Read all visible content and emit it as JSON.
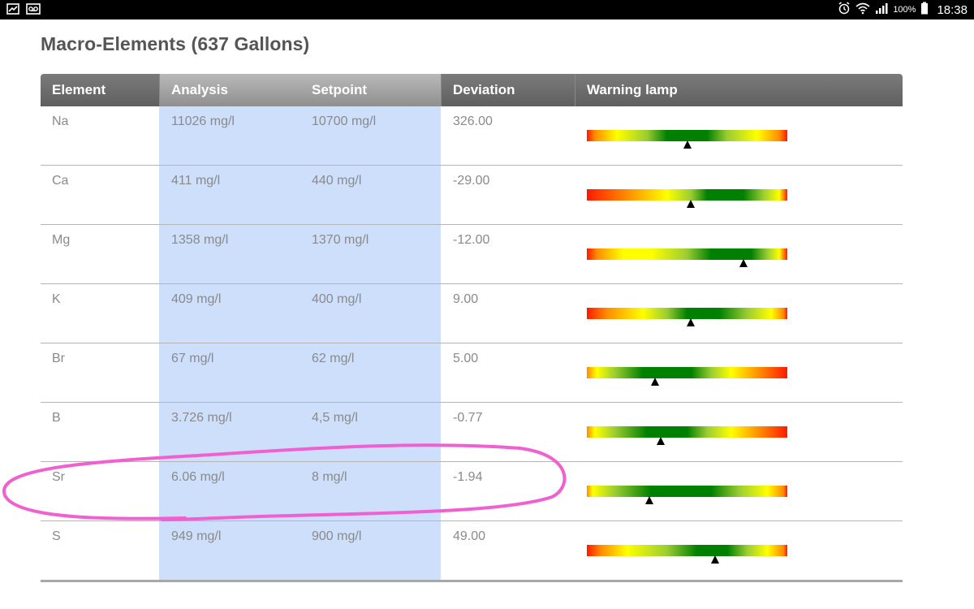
{
  "status_bar": {
    "left_icons": [
      "image-icon",
      "voicemail-icon"
    ],
    "right_icons": [
      "alarm-icon",
      "wifi-icon",
      "signal-icon",
      "battery-icon"
    ],
    "battery": "100%",
    "time": "18:38"
  },
  "title": "Macro-Elements (637 Gallons)",
  "table": {
    "headers": {
      "element": "Element",
      "analysis": "Analysis",
      "setpoint": "Setpoint",
      "deviation": "Deviation",
      "warning_lamp": "Warning lamp"
    },
    "rows": [
      {
        "element": "Na",
        "analysis": "11026 mg/l",
        "setpoint": "10700 mg/l",
        "deviation": "326.00",
        "lamp_level": 0.5,
        "lamp_gradient": "linear-gradient(to right,#ff1a00 0%,#ff8c00 4%,#ffff00 15%,#9acd32 30%,#008000 40%,#008000 60%,#9acd32 70%,#ffff00 85%,#ff8c00 96%,#ff1a00 100%)"
      },
      {
        "element": "Ca",
        "analysis": "411 mg/l",
        "setpoint": "440 mg/l",
        "deviation": "-29.00",
        "lamp_level": 0.52,
        "lamp_gradient": "linear-gradient(to right,#ff1a00 0%,#ff8c00 20%,#ffff00 40%,#9acd32 52%,#008000 60%,#008000 78%,#9acd32 88%,#ffff00 96%,#ff1a00 100%)"
      },
      {
        "element": "Mg",
        "analysis": "1358 mg/l",
        "setpoint": "1370 mg/l",
        "deviation": "-12.00",
        "lamp_level": 0.78,
        "lamp_gradient": "linear-gradient(to right,#ff1a00 0%,#ff8c00 5%,#ffff00 18%,#ffff00 32%,#9acd32 50%,#008000 62%,#008000 82%,#9acd32 90%,#ffff00 96%,#ff1a00 100%)"
      },
      {
        "element": "K",
        "analysis": "409 mg/l",
        "setpoint": "400 mg/l",
        "deviation": "9.00",
        "lamp_level": 0.52,
        "lamp_gradient": "linear-gradient(to right,#ff1a00 0%,#ff8c00 10%,#ffff00 28%,#9acd32 40%,#008000 50%,#008000 66%,#9acd32 80%,#ffff00 92%,#ff8c00 98%,#ff1a00 100%)"
      },
      {
        "element": "Br",
        "analysis": "67 mg/l",
        "setpoint": "62 mg/l",
        "deviation": "5.00",
        "lamp_level": 0.34,
        "lamp_gradient": "linear-gradient(to right,#ff8c00 0%,#ffff00 5%,#9acd32 14%,#008000 28%,#008000 52%,#9acd32 62%,#ffff00 72%,#ff8c00 86%,#ff1a00 100%)"
      },
      {
        "element": "B",
        "analysis": "3.726 mg/l",
        "setpoint": "4,5 mg/l",
        "deviation": "-0.77",
        "lamp_level": 0.37,
        "lamp_gradient": "linear-gradient(to right,#ff8c00 0%,#ffff00 4%,#9acd32 14%,#008000 30%,#008000 50%,#9acd32 60%,#ffff00 72%,#ff8c00 86%,#ff1a00 100%)"
      },
      {
        "element": "Sr",
        "analysis": "6.06 mg/l",
        "setpoint": "8 mg/l",
        "deviation": "-1.94",
        "lamp_level": 0.31,
        "lamp_gradient": "linear-gradient(to right,#ff8c00 0%,#ffff00 3%,#9acd32 14%,#008000 32%,#008000 62%,#9acd32 76%,#ffff00 90%,#ff8c00 98%,#ff1a00 100%)"
      },
      {
        "element": "S",
        "analysis": "949 mg/l",
        "setpoint": "900 mg/l",
        "deviation": "49.00",
        "lamp_level": 0.64,
        "lamp_gradient": "linear-gradient(to right,#ff1a00 0%,#ff8c00 7%,#ffff00 20%,#9acd32 40%,#008000 55%,#008000 70%,#9acd32 80%,#ffff00 90%,#ff8c00 98%,#ff1a00 100%)"
      }
    ]
  },
  "colors": {
    "header_dark": "#6b6b6b",
    "header_highlight": "#a3a3a3",
    "column_highlight": "#cddffb",
    "text_muted": "#8a8a8a",
    "title": "#555555",
    "annotation": "#f060d0"
  },
  "annotation": {
    "shape": "hand-drawn ellipse",
    "color": "#f060d0",
    "encircles_row": "Sr"
  }
}
